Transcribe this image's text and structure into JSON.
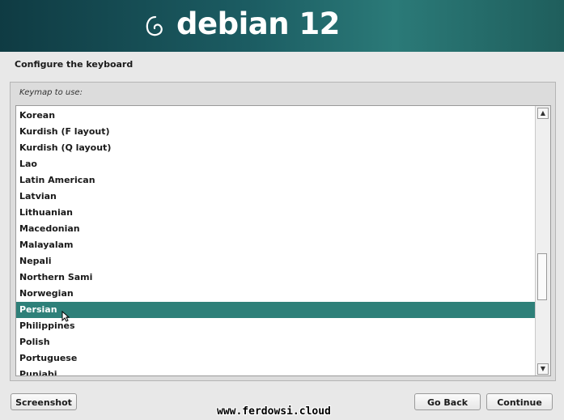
{
  "banner": {
    "logo_text": "debian 12"
  },
  "page": {
    "title": "Configure the keyboard"
  },
  "keymap": {
    "label": "Keymap to use:",
    "items": [
      "Korean",
      "Kurdish (F layout)",
      "Kurdish (Q layout)",
      "Lao",
      "Latin American",
      "Latvian",
      "Lithuanian",
      "Macedonian",
      "Malayalam",
      "Nepali",
      "Northern Sami",
      "Norwegian",
      "Persian",
      "Philippines",
      "Polish",
      "Portuguese",
      "Punjabi"
    ],
    "selected": "Persian"
  },
  "scrollbar": {
    "up_icon": "arrow-up-icon",
    "down_icon": "arrow-down-icon"
  },
  "buttons": {
    "screenshot": "Screenshot",
    "go_back": "Go Back",
    "continue": "Continue"
  },
  "watermark": "www.ferdowsi.cloud",
  "colors": {
    "selection": "#2e8079",
    "banner": "#1c5d63"
  }
}
